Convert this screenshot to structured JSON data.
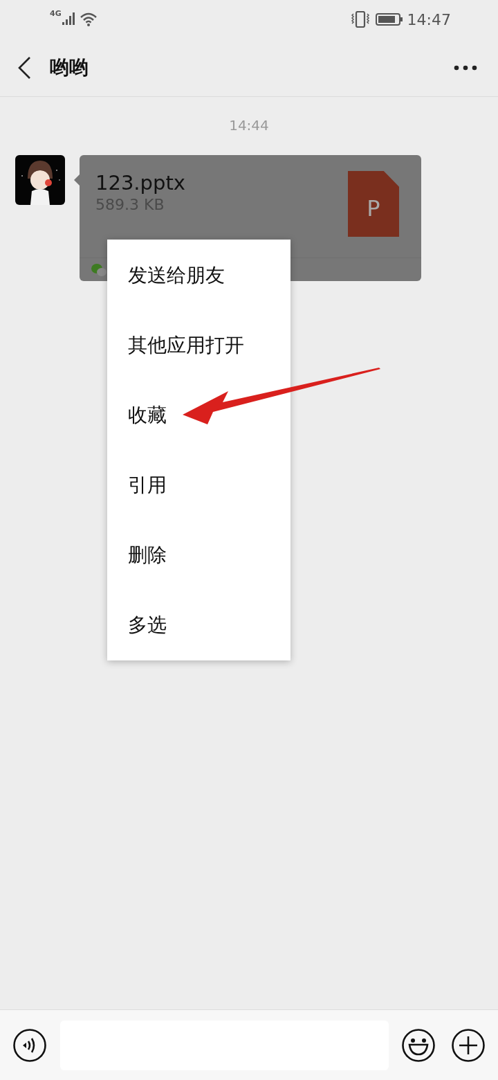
{
  "status_bar": {
    "network": "4G",
    "time": "14:47"
  },
  "header": {
    "title": "哟哟"
  },
  "chat": {
    "timestamp": "14:44",
    "message": {
      "kind": "file",
      "file_name": "123.pptx",
      "file_size": "589.3 KB",
      "file_icon_letter": "P",
      "selected": true
    }
  },
  "context_menu": {
    "items": [
      {
        "label": "发送给朋友",
        "highlighted": false
      },
      {
        "label": "其他应用打开",
        "highlighted": false
      },
      {
        "label": "收藏",
        "highlighted": true
      },
      {
        "label": "引用",
        "highlighted": false
      },
      {
        "label": "删除",
        "highlighted": false
      },
      {
        "label": "多选",
        "highlighted": false
      }
    ]
  }
}
